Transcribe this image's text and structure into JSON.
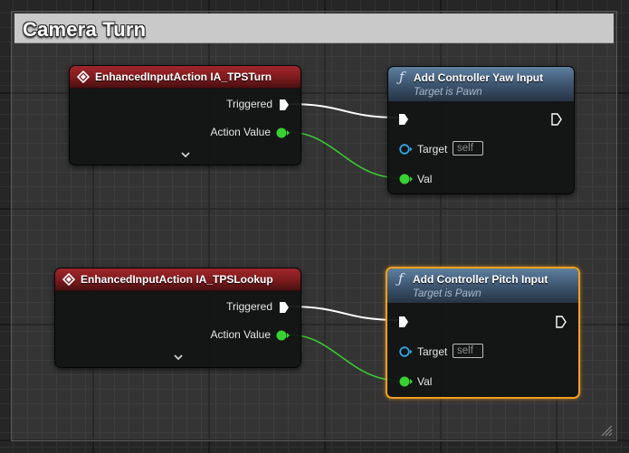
{
  "comment": {
    "title": "Camera Turn"
  },
  "nodes": {
    "turn_event": {
      "title": "EnhancedInputAction IA_TPSTurn",
      "pins": {
        "triggered": "Triggered",
        "action_value": "Action Value"
      }
    },
    "lookup_event": {
      "title": "EnhancedInputAction IA_TPSLookup",
      "pins": {
        "triggered": "Triggered",
        "action_value": "Action Value"
      }
    },
    "yaw_input": {
      "title": "Add Controller Yaw Input",
      "subtitle": "Target is Pawn",
      "pins": {
        "target": "Target",
        "target_default": "self",
        "val": "Val"
      }
    },
    "pitch_input": {
      "title": "Add Controller Pitch Input",
      "subtitle": "Target is Pawn",
      "pins": {
        "target": "Target",
        "target_default": "self",
        "val": "Val"
      }
    }
  },
  "colors": {
    "event_header": "#8f2226",
    "function_header": "#4a6885",
    "exec_wire": "#ffffff",
    "float_pin": "#38d132",
    "object_pin": "#2fa8e6",
    "selection": "#f0a020"
  },
  "icons": {
    "event": "event-diamond-icon",
    "function": "function-f-icon",
    "exec": "exec-arrow-icon",
    "expand": "chevron-down-icon"
  }
}
